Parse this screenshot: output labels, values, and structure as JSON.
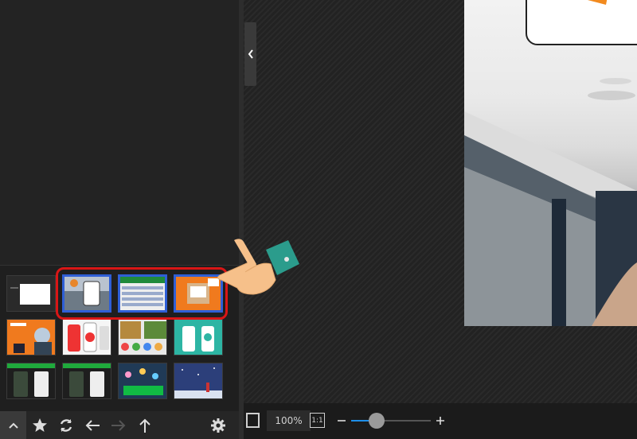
{
  "zoom": {
    "level": "100%",
    "one_to_one": "1:1",
    "slider_fraction": 0.32
  },
  "toolbar": {
    "icons": [
      "chevron-up-icon",
      "star-icon",
      "refresh-icon",
      "arrow-left-icon",
      "arrow-right-icon",
      "arrow-up-icon",
      "gear-icon"
    ]
  },
  "thumbnails": {
    "rows": 3,
    "columns": 4,
    "selected": [
      1,
      2,
      3
    ]
  },
  "colors": {
    "highlight": "#d91616",
    "selected_border": "#2f5fd6",
    "background": "#1e1e1e"
  }
}
